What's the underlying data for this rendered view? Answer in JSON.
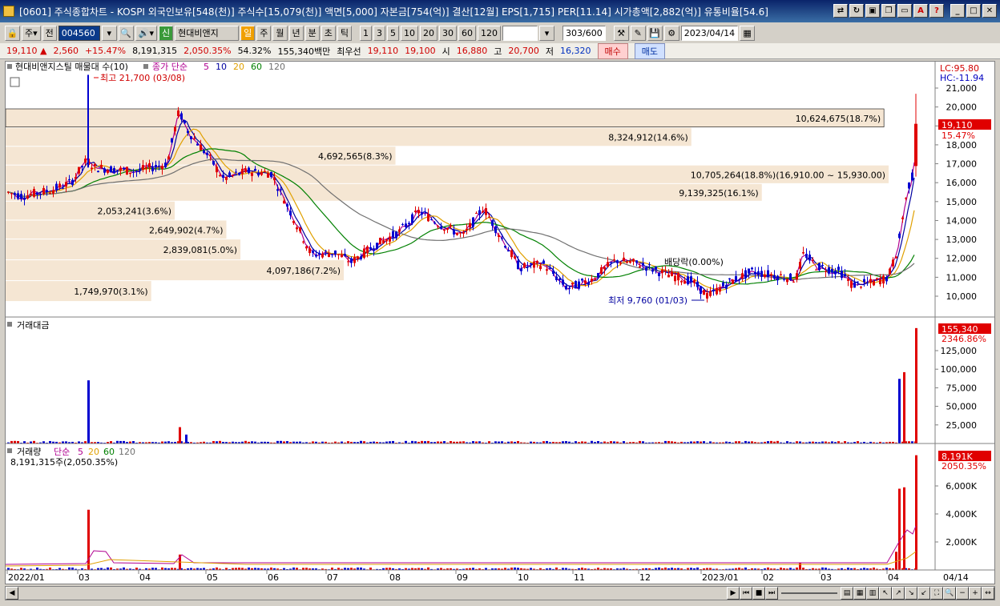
{
  "window": {
    "title": "[0601] 주식종합차트 - KOSPI 외국인보유[548(천)] 주식수[15,079(천)] 액면[5,000] 자본금[754(억)] 결산[12월] EPS[1,715] PER[11.14] 시가총액[2,882(억)] 유통비율[54.6]"
  },
  "toolbar": {
    "market": "주",
    "prev_label": "전",
    "code": "004560",
    "stock_name": "현대비앤지",
    "period_buttons": [
      "일",
      "주",
      "월",
      "년",
      "분",
      "초",
      "틱"
    ],
    "num_buttons": [
      "1",
      "3",
      "5",
      "10",
      "20",
      "30",
      "60",
      "120"
    ],
    "count": "303",
    "count_total": "/600",
    "date": "2023/04/14"
  },
  "quote": {
    "price": "19,110",
    "arrow": "▲",
    "change": "2,560",
    "change_pct": "+15.47%",
    "volume": "8,191,315",
    "volume_ratio": "2,050.35%",
    "turnover": "54.32%",
    "amount": "155,340백만",
    "best_label": "최우선",
    "ask": "19,110",
    "bid": "19,100",
    "open_label": "시",
    "open": "16,880",
    "high_label": "고",
    "high": "20,700",
    "low_label": "저",
    "low": "16,320",
    "buy_label": "매수",
    "sell_label": "매도"
  },
  "price_panel": {
    "title": "현대비앤지스틸 매물대 수(10)",
    "ma_label": "종가 단순",
    "ma_periods": [
      "5",
      "10",
      "20",
      "60",
      "120"
    ],
    "lc": "LC:95.80",
    "hc": "HC:-11.94",
    "y_ticks": [
      "21,000",
      "20,000",
      "19,000",
      "18,000",
      "17,000",
      "16,000",
      "15,000",
      "14,000",
      "13,000",
      "12,000",
      "11,000",
      "10,000"
    ],
    "price_tag": "19,110",
    "price_tag_pct": "15.47%",
    "high_note": "최고 21,700 (03/08)",
    "low_note": "최저 9,760 (01/03)",
    "dividend_note": "배당락(0.00%)",
    "volume_profile": [
      "1,749,970(3.1%)",
      "4,097,186(7.2%)",
      "2,839,081(5.0%)",
      "2,649,902(4.7%)",
      "2,053,241(3.6%)",
      "9,139,325(16.1%)",
      "10,705,264(18.8%)(16,910.00 ~ 15,930.00)",
      "4,692,565(8.3%)",
      "8,324,912(14.6%)",
      "10,624,675(18.7%)"
    ]
  },
  "amount_panel": {
    "title": "거래대금",
    "y_ticks": [
      "125,000",
      "100,000",
      "75,000",
      "50,000",
      "25,000"
    ],
    "tag": "155,340",
    "tag_pct": "2346.86%"
  },
  "volume_panel": {
    "title": "거래량",
    "ma_label": "단순",
    "ma_periods": [
      "5",
      "20",
      "60",
      "120"
    ],
    "sub": "8,191,315주(2,050.35%)",
    "y_ticks": [
      "6,000K",
      "4,000K",
      "2,000K"
    ],
    "tag": "8,191K",
    "tag_pct": "2050.35%"
  },
  "x_axis": {
    "labels": [
      "2022/01",
      "03",
      "04",
      "05",
      "06",
      "07",
      "08",
      "09",
      "10",
      "11",
      "12",
      "2023/01",
      "02",
      "03",
      "04"
    ],
    "last_label": "04/14"
  },
  "colors": {
    "up": "#e00000",
    "down": "#0000d0",
    "ma5": "#b00090",
    "ma10": "#0000a0",
    "ma20": "#e0a000",
    "ma60": "#008000",
    "ma120": "#707070",
    "profile": "#f5e6d3"
  }
}
